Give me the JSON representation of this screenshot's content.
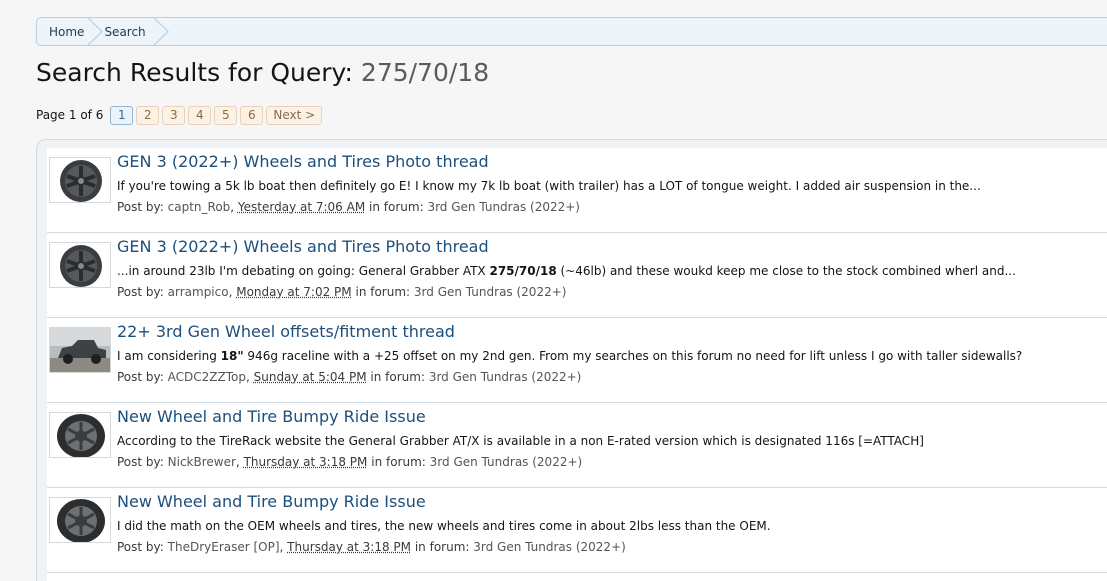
{
  "breadcrumb": {
    "home": "Home",
    "search": "Search"
  },
  "title": {
    "prefix": "Search Results for Query:",
    "query": "275/70/18"
  },
  "pagination": {
    "info": "Page 1 of 6",
    "pages": [
      "1",
      "2",
      "3",
      "4",
      "5",
      "6"
    ],
    "current": "1",
    "next": "Next >"
  },
  "results": [
    {
      "title": "GEN 3 (2022+) Wheels and Tires Photo thread",
      "snippet_before": "If you're towing a 5k lb boat then definitely go E! I know my 7k lb boat (with trailer) has a LOT of tongue weight. I added air suspension in the...",
      "snippet_bold": "",
      "snippet_after": "",
      "meta_label": "Post by:",
      "user": "captn_Rob",
      "date": "Yesterday at 7:06 AM",
      "forum_label": "in forum:",
      "forum": "3rd Gen Tundras (2022+)",
      "thumb": "dark-wheel"
    },
    {
      "title": "GEN 3 (2022+) Wheels and Tires Photo thread",
      "snippet_before": "...in around 23lb I'm debating on going: General Grabber ATX ",
      "snippet_bold": "275/70/18",
      "snippet_after": " (~46lb) and these woukd keep me close to the stock combined wherl and...",
      "meta_label": "Post by:",
      "user": "arrampico",
      "date": "Monday at 7:02 PM",
      "forum_label": "in forum:",
      "forum": "3rd Gen Tundras (2022+)",
      "thumb": "dark-wheel"
    },
    {
      "title": "22+ 3rd Gen Wheel offsets/fitment thread",
      "snippet_before": "I am considering ",
      "snippet_bold": "18\"",
      "snippet_after": " 946g raceline with a +25 offset on my 2nd gen. From my searches on this forum no need for lift unless I go with taller sidewalls?",
      "meta_label": "Post by:",
      "user": "ACDC2ZZTop",
      "date": "Sunday at 5:04 PM",
      "forum_label": "in forum:",
      "forum": "3rd Gen Tundras (2022+)",
      "thumb": "truck-photo"
    },
    {
      "title": "New Wheel and Tire Bumpy Ride Issue",
      "snippet_before": "According to the TireRack website the General Grabber AT/X is available in a non E-rated version which is designated 116s [=ATTACH]",
      "snippet_bold": "",
      "snippet_after": "",
      "meta_label": "Post by:",
      "user": "NickBrewer",
      "date": "Thursday at 3:18 PM",
      "forum_label": "in forum:",
      "forum": "3rd Gen Tundras (2022+)",
      "thumb": "tire-wheel"
    },
    {
      "title": "New Wheel and Tire Bumpy Ride Issue",
      "snippet_before": "I did the math on the OEM wheels and tires, the new wheels and tires come in about 2lbs less than the OEM.",
      "snippet_bold": "",
      "snippet_after": "",
      "meta_label": "Post by:",
      "user": "TheDryEraser [OP]",
      "date": "Thursday at 3:18 PM",
      "forum_label": "in forum:",
      "forum": "3rd Gen Tundras (2022+)",
      "thumb": "tire-wheel"
    }
  ]
}
